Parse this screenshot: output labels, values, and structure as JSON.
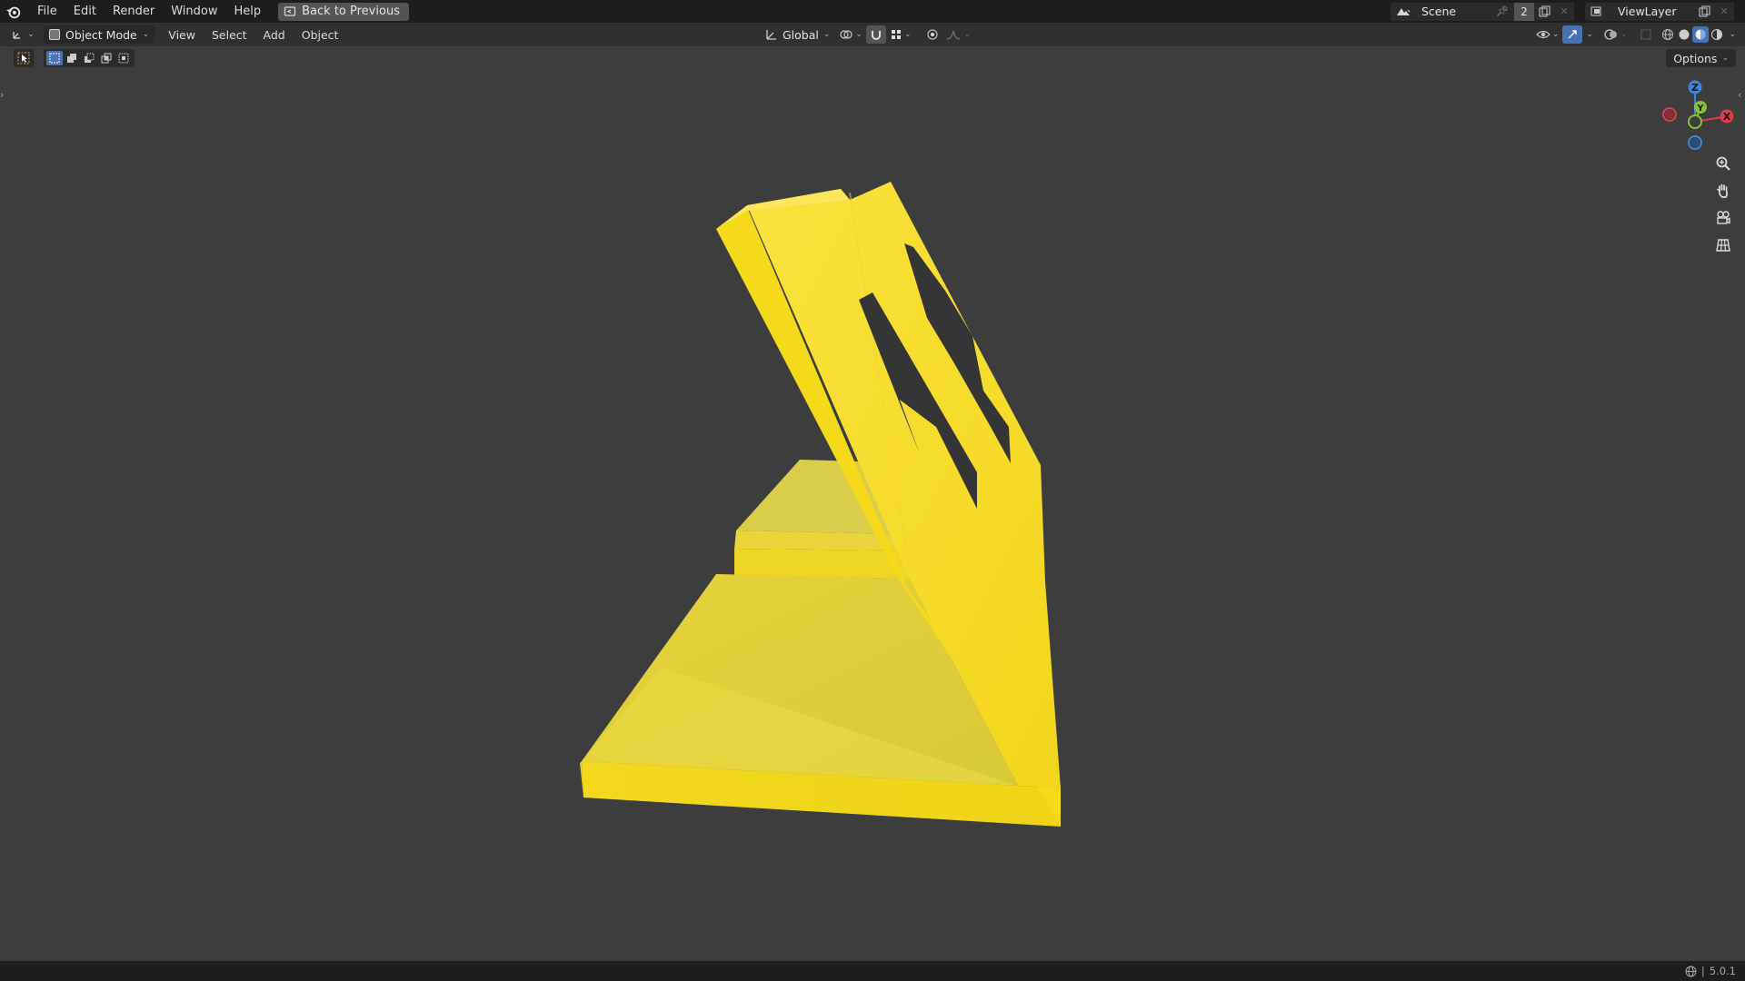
{
  "menubar": {
    "items": [
      "File",
      "Edit",
      "Render",
      "Window",
      "Help"
    ],
    "back_button": "Back to Previous"
  },
  "scene": {
    "name": "Scene",
    "user_count": "2"
  },
  "view_layer": {
    "name": "ViewLayer"
  },
  "viewport_header": {
    "mode": "Object Mode",
    "menus": [
      "View",
      "Select",
      "Add",
      "Object"
    ],
    "transform_orientation": "Global"
  },
  "options_label": "Options",
  "gizmo": {
    "z_label": "Z",
    "y_label": "Y",
    "x_label": "X",
    "colors": {
      "x": "#e23c4f",
      "y": "#8bc03a",
      "z": "#3e85db"
    }
  },
  "nav_buttons": [
    "zoom-icon",
    "pan-hand-icon",
    "camera-view-icon",
    "orthographic-grid-icon"
  ],
  "status": {
    "version": "5.0.1"
  },
  "colors": {
    "viewport_bg": "#3d3d3d",
    "header_bg": "#303030",
    "topbar_bg": "#1d1d1d",
    "accent": "#4772b3",
    "model_yellow": "#f2d926"
  }
}
